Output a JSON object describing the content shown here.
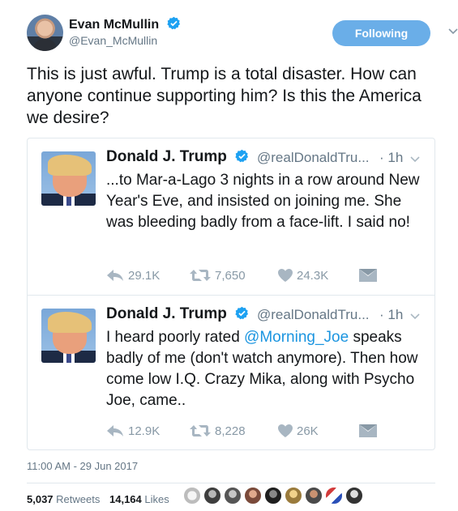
{
  "author": {
    "name": "Evan McMullin",
    "handle": "@Evan_McMullin"
  },
  "follow_button": {
    "label": "Following"
  },
  "tweet": {
    "text": "This is just awful. Trump is a total disaster. How can anyone continue supporting him? Is this the America we desire?",
    "timestamp": "11:00 AM - 29 Jun 2017"
  },
  "quoted": [
    {
      "name": "Donald J. Trump",
      "handle": "@realDonaldTru...",
      "time": "· 1h",
      "text_before": "...to Mar-a-Lago 3 nights in a row around New Year's Eve, and insisted on joining me. She was bleeding badly from a face-lift. I said no!",
      "mention": "",
      "text_after": "",
      "replies": "29.1K",
      "retweets": "7,650",
      "likes": "24.3K"
    },
    {
      "name": "Donald J. Trump",
      "handle": "@realDonaldTru...",
      "time": "· 1h",
      "text_before": "I heard poorly rated ",
      "mention": "@Morning_Joe",
      "text_after": " speaks badly of me (don't watch anymore). Then how come low I.Q. Crazy Mika, along with Psycho Joe, came..",
      "replies": "12.9K",
      "retweets": "8,228",
      "likes": "26K"
    }
  ],
  "stats": {
    "retweets_count": "5,037",
    "retweets_label": "Retweets",
    "likes_count": "14,164",
    "likes_label": "Likes"
  },
  "colors": {
    "accent": "#1b95e0",
    "follow_bg": "#6aaee8",
    "muted": "#657786",
    "action": "#8899a6"
  },
  "icons": [
    "verified-icon",
    "chevron-down-icon",
    "reply-icon",
    "retweet-icon",
    "heart-icon",
    "dm-icon"
  ]
}
